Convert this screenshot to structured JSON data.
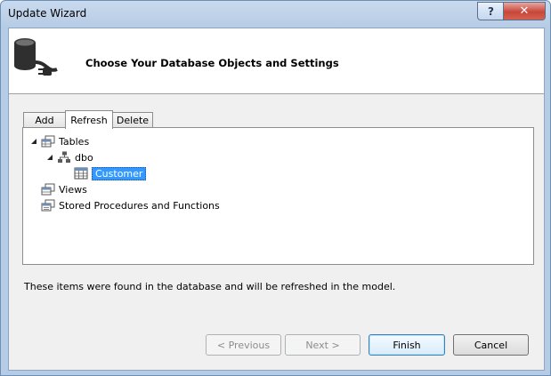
{
  "window": {
    "title": "Update Wizard",
    "help_label": "?",
    "close_label": "✕"
  },
  "header": {
    "title": "Choose Your Database Objects and Settings"
  },
  "tabs": [
    {
      "label": "Add"
    },
    {
      "label": "Refresh",
      "active": true
    },
    {
      "label": "Delete"
    }
  ],
  "tree": {
    "tables": "Tables",
    "dbo": "dbo",
    "customer": "Customer",
    "views": "Views",
    "procedures": "Stored Procedures and Functions"
  },
  "info_text": "These items were found in the database and will be refreshed in the model.",
  "buttons": {
    "previous": "< Previous",
    "next": "Next >",
    "finish": "Finish",
    "cancel": "Cancel"
  },
  "colors": {
    "selection": "#3399ff",
    "titlebar": "#b6cbe5",
    "close": "#c7473b"
  }
}
